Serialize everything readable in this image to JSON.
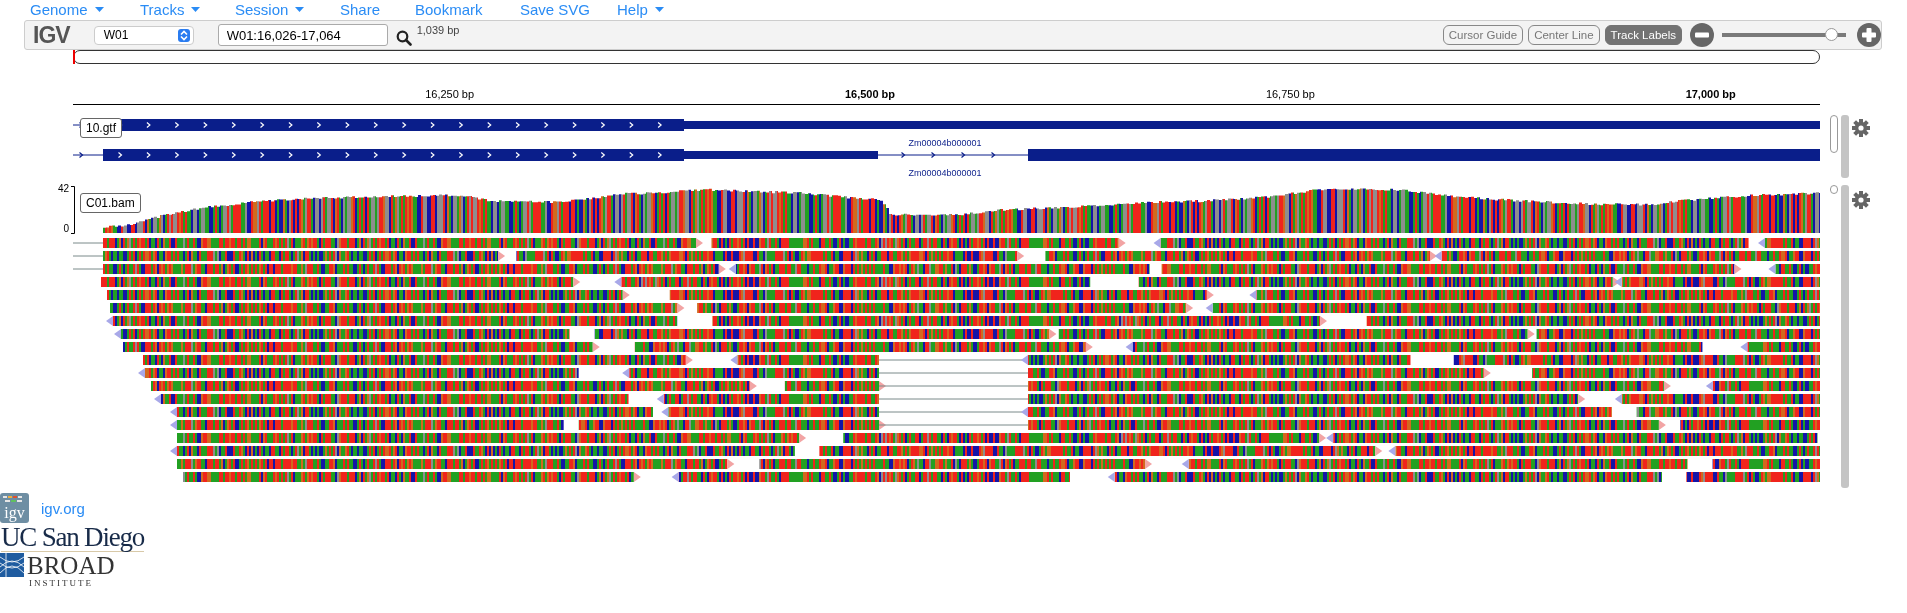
{
  "menu": [
    {
      "label": "Genome",
      "dropdown": true
    },
    {
      "label": "Tracks",
      "dropdown": true
    },
    {
      "label": "Session",
      "dropdown": true
    },
    {
      "label": "Share",
      "dropdown": false
    },
    {
      "label": "Bookmark",
      "dropdown": false
    },
    {
      "label": "Save SVG",
      "dropdown": false
    },
    {
      "label": "Help",
      "dropdown": true
    }
  ],
  "toolbar": {
    "logo": "IGV",
    "genome": "W01",
    "locus": "W01:16,026-17,064",
    "region_width": "1,039 bp",
    "toggles": [
      {
        "label": "Cursor Guide",
        "selected": false
      },
      {
        "label": "Center Line",
        "selected": false
      },
      {
        "label": "Track Labels",
        "selected": true
      }
    ],
    "zoom_slider": {
      "level": 0.93
    }
  },
  "ruler": {
    "ticks": [
      {
        "label": "16,250 bp",
        "bold": false
      },
      {
        "label": "16,500 bp",
        "bold": true
      },
      {
        "label": "16,750 bp",
        "bold": false
      },
      {
        "label": "17,000 bp",
        "bold": true
      }
    ]
  },
  "tracks": [
    {
      "kind": "annotation",
      "name": "10.gtf",
      "transcripts": [
        {
          "kind": "single",
          "label": "Zm00004b000001"
        },
        {
          "kind": "spliced",
          "label": "Zm00004b000001"
        }
      ]
    },
    {
      "kind": "alignment",
      "name": "C01.bam",
      "scale_max": "42",
      "scale_min": "0"
    }
  ],
  "footer": {
    "icon_text": "igv",
    "link": "igv.org",
    "institutions": [
      {
        "kind": "ucsd",
        "name": "UC San Diego"
      },
      {
        "kind": "broad",
        "name": "BROAD",
        "subtitle": "INSTITUTE"
      }
    ]
  }
}
